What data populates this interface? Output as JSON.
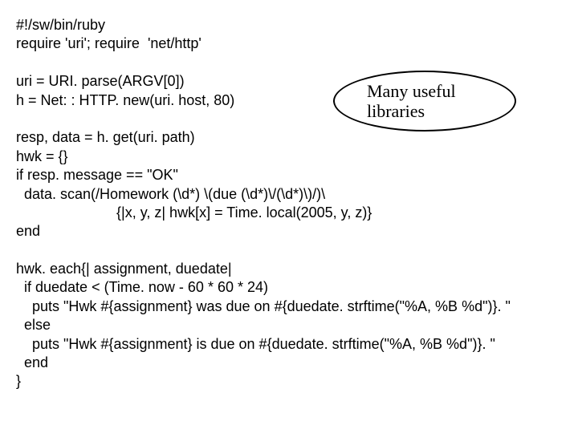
{
  "code": {
    "l1": "#!/sw/bin/ruby",
    "l2": "require 'uri'; require  'net/http'",
    "l3": "",
    "l4": "uri = URI. parse(ARGV[0])",
    "l5": "h = Net: : HTTP. new(uri. host, 80)",
    "l6": "",
    "l7": "resp, data = h. get(uri. path)",
    "l8": "hwk = {}",
    "l9": "if resp. message == \"OK\"",
    "l10": "  data. scan(/Homework (\\d*) \\(due (\\d*)\\/(\\d*)\\)/)\\",
    "l11": "                         {|x, y, z| hwk[x] = Time. local(2005, y, z)}",
    "l12": "end",
    "l13": "",
    "l14": "hwk. each{| assignment, duedate|",
    "l15": "  if duedate < (Time. now - 60 * 60 * 24)",
    "l16": "    puts \"Hwk #{assignment} was due on #{duedate. strftime(\"%A, %B %d\")}. \"",
    "l17": "  else",
    "l18": "    puts \"Hwk #{assignment} is due on #{duedate. strftime(\"%A, %B %d\")}. \"",
    "l19": "  end",
    "l20": "}"
  },
  "callout": {
    "text": "Many useful libraries"
  }
}
